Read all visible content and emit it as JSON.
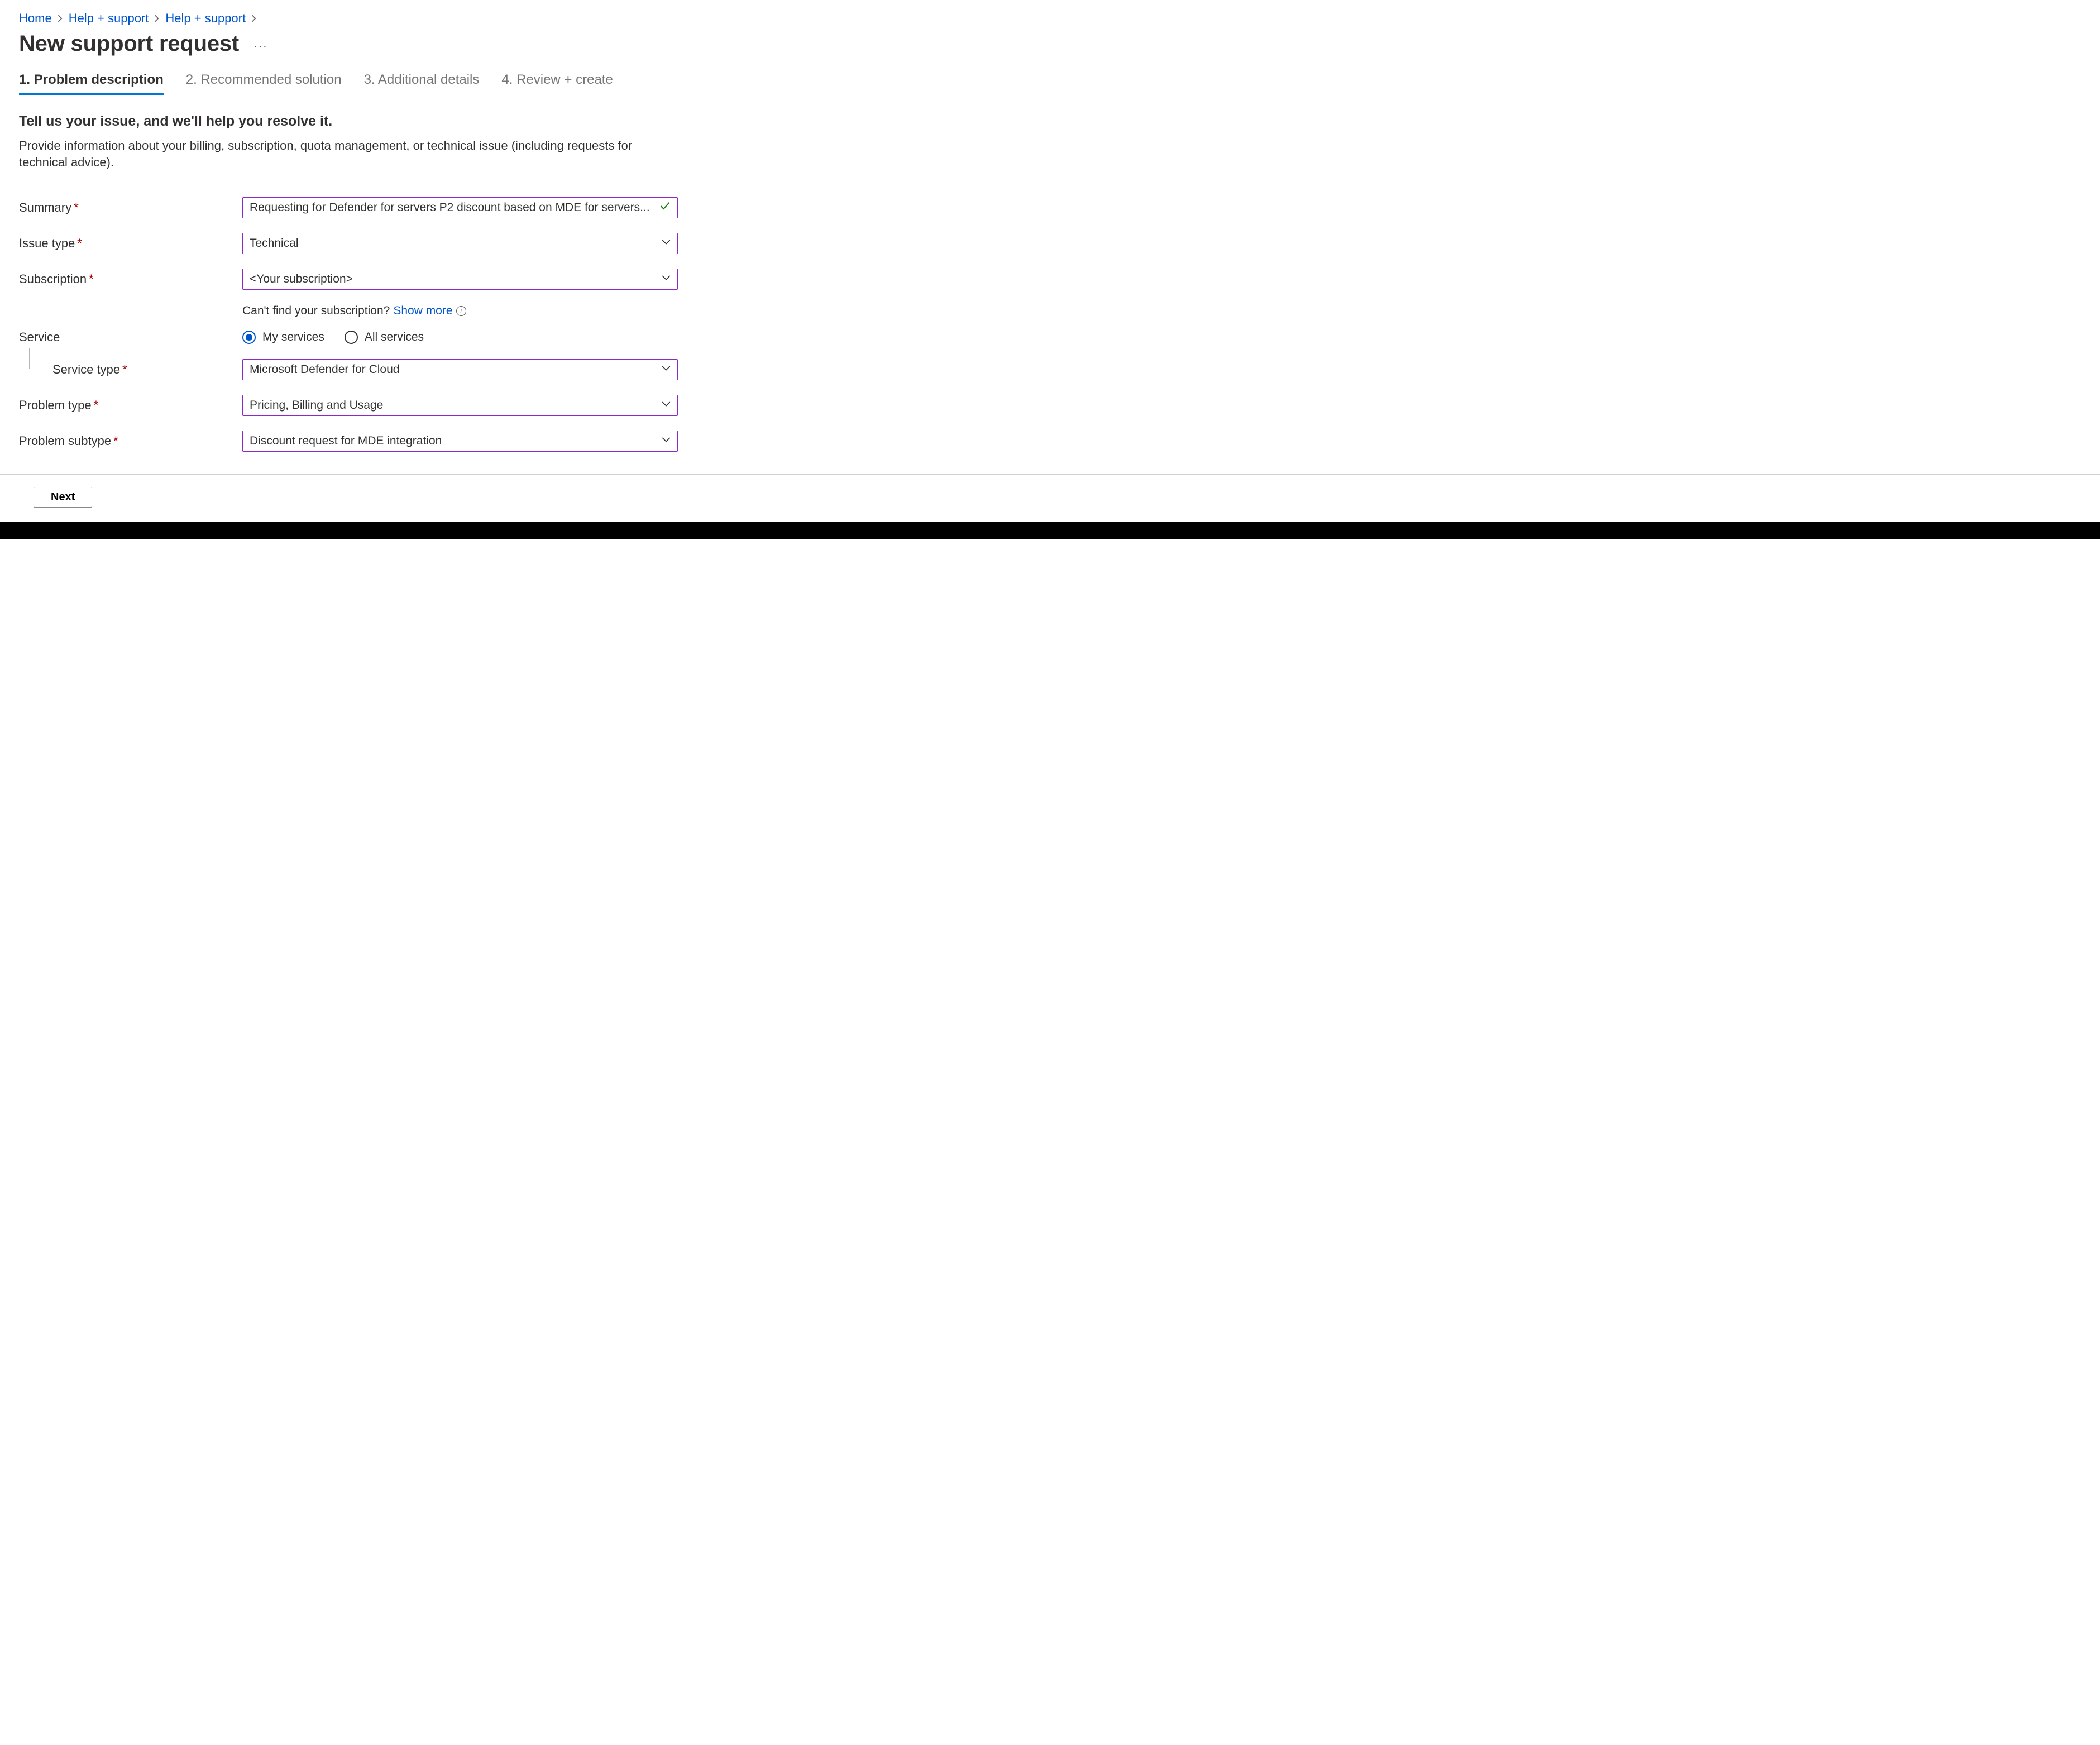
{
  "breadcrumb": {
    "items": [
      {
        "label": "Home"
      },
      {
        "label": "Help + support"
      },
      {
        "label": "Help + support"
      }
    ]
  },
  "page": {
    "title": "New support request",
    "more_label": "···"
  },
  "tabs": [
    {
      "label": "1. Problem description",
      "active": true
    },
    {
      "label": "2. Recommended solution",
      "active": false
    },
    {
      "label": "3. Additional details",
      "active": false
    },
    {
      "label": "4. Review + create",
      "active": false
    }
  ],
  "section": {
    "heading": "Tell us your issue, and we'll help you resolve it.",
    "description": "Provide information about your billing, subscription, quota management, or technical issue (including requests for technical advice)."
  },
  "form": {
    "summary": {
      "label": "Summary",
      "value": "Requesting for Defender for servers P2 discount based on MDE for servers..."
    },
    "issue_type": {
      "label": "Issue type",
      "value": "Technical"
    },
    "subscription": {
      "label": "Subscription",
      "value": "<Your subscription>"
    },
    "subscription_hint": {
      "prefix": "Can't find your subscription? ",
      "link": "Show more"
    },
    "service": {
      "label": "Service",
      "options": {
        "my": "My services",
        "all": "All services"
      },
      "selected": "my"
    },
    "service_type": {
      "label": "Service type",
      "value": "Microsoft Defender for Cloud"
    },
    "problem_type": {
      "label": "Problem type",
      "value": "Pricing, Billing and Usage"
    },
    "problem_subtype": {
      "label": "Problem subtype",
      "value": "Discount request for MDE integration"
    }
  },
  "footer": {
    "next": "Next"
  }
}
